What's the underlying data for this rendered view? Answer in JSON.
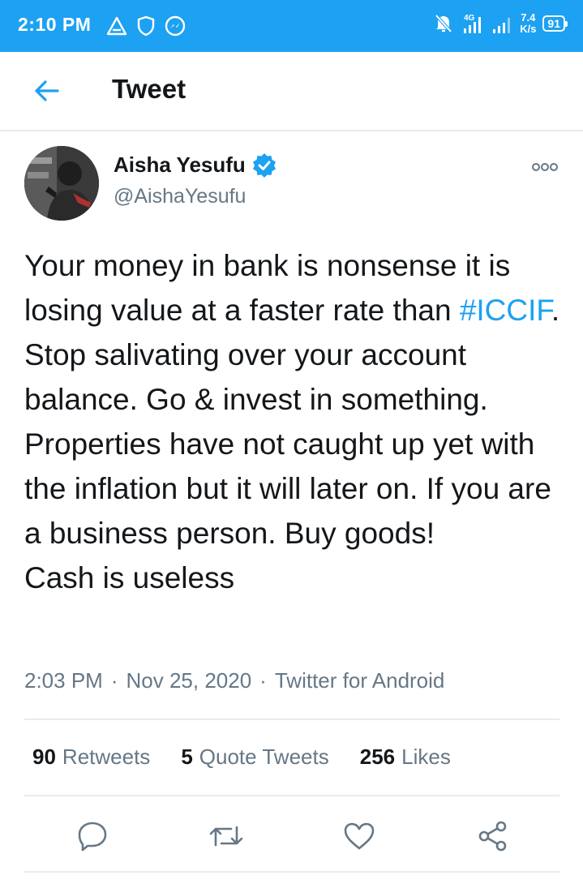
{
  "status_bar": {
    "time": "2:10 PM",
    "net_speed_value": "7.4",
    "net_speed_unit": "K/s",
    "network_type": "4G",
    "battery": "91",
    "icons_left": [
      "alert-triangle-icon",
      "shield-icon",
      "messenger-icon"
    ],
    "icons_right": [
      "bell-off-icon",
      "signal-4g-icon",
      "signal-icon"
    ]
  },
  "header": {
    "title": "Tweet",
    "back_icon": "arrow-left-icon"
  },
  "tweet": {
    "author_name": "Aisha Yesufu",
    "verified": true,
    "handle": "@AishaYesufu",
    "text_before_hashtag": "Your money in bank is nonsense it is losing value at a faster rate than ",
    "hashtag": "#ICCIF",
    "text_after_hashtag": ". Stop salivating over your account balance. Go & invest in something. Properties have not caught up yet with the inflation but it will later on. If you are a business person. Buy goods!",
    "text_last_line": "Cash is useless",
    "time": "2:03 PM",
    "date": "Nov 25, 2020",
    "separator": "·",
    "source": "Twitter for Android"
  },
  "stats": {
    "retweets_count": "90",
    "retweets_label": "Retweets",
    "quotes_count": "5",
    "quotes_label": "Quote Tweets",
    "likes_count": "256",
    "likes_label": "Likes"
  },
  "actions": [
    "reply-icon",
    "retweet-icon",
    "like-icon",
    "share-icon"
  ],
  "colors": {
    "accent": "#1da1f2",
    "text": "#14171a",
    "secondary": "#657786",
    "divider": "#e6ecf0"
  }
}
